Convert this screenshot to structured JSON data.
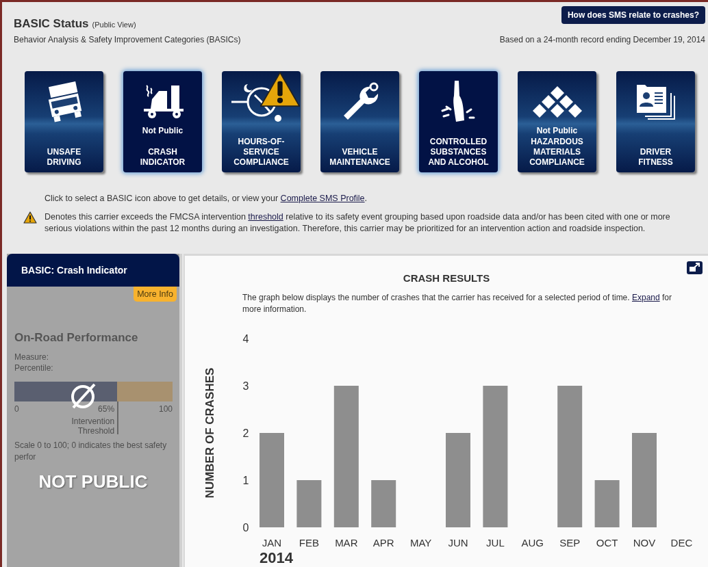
{
  "header": {
    "title": "BASIC Status",
    "title_note": "(Public View)",
    "subtitle": "Behavior Analysis & Safety Improvement Categories (BASICs)",
    "help_button": "How does SMS relate to crashes?",
    "record_note": "Based on a 24-month record ending December 19, 2014"
  },
  "basics": [
    {
      "kind": "truck",
      "label_lines": [
        "UNSAFE",
        "DRIVING"
      ],
      "highlighted": false,
      "warning": false
    },
    {
      "kind": "crash",
      "status": "Not Public",
      "label_lines": [
        "CRASH",
        "INDICATOR"
      ],
      "highlighted": true,
      "warning": false
    },
    {
      "kind": "clock",
      "label_lines": [
        "HOURS-OF-",
        "SERVICE",
        "COMPLIANCE"
      ],
      "highlighted": false,
      "warning": true
    },
    {
      "kind": "wrench",
      "label_lines": [
        "VEHICLE",
        "MAINTENANCE"
      ],
      "highlighted": false,
      "warning": false
    },
    {
      "kind": "bottle",
      "label_lines": [
        "CONTROLLED",
        "SUBSTANCES",
        "AND ALCOHOL"
      ],
      "highlighted": true,
      "warning": false
    },
    {
      "kind": "diamonds",
      "status": "Not Public",
      "label_lines": [
        "HAZARDOUS",
        "MATERIALS",
        "COMPLIANCE"
      ],
      "highlighted": false,
      "warning": false
    },
    {
      "kind": "idcard",
      "label_lines": [
        "DRIVER",
        "FITNESS"
      ],
      "highlighted": false,
      "warning": false
    }
  ],
  "notes": [
    {
      "kind": "plain",
      "before": "Click to select a BASIC icon above to get details, or view your ",
      "link": "Complete SMS Profile",
      "after": "."
    },
    {
      "kind": "warning",
      "before": "Denotes this carrier exceeds the FMCSA intervention ",
      "link": "threshold",
      "after": " relative to its safety event grouping based upon roadside data and/or has been cited with one or more serious violations within the past 12 months during an investigation. Therefore, this carrier may be prioritized for an intervention action and roadside inspection."
    }
  ],
  "panel": {
    "title": "BASIC: Crash Indicator",
    "more_info": "More Info",
    "section": "On-Road Performance",
    "measure": "Measure:",
    "percentile": "Percentile:",
    "scale": {
      "level": 0.65,
      "min": "0",
      "threshold": "65%",
      "max": "100",
      "threshold_label": "Intervention Threshold"
    },
    "footnote": "Scale 0 to 100; 0 indicates the best safety perfor",
    "overlay_text": "NOT PUBLIC"
  },
  "results": {
    "title": "CRASH RESULTS",
    "description": "The graph below displays the number of crashes that the carrier has received for a selected period of time. ",
    "link": "Expand",
    "description_after": " for more information.",
    "year": "2014",
    "chart_data": {
      "type": "bar",
      "ylabel": "NUMBER OF CRASHES",
      "categories": [
        "JAN",
        "FEB",
        "MAR",
        "APR",
        "MAY",
        "JUN",
        "JUL",
        "AUG",
        "SEP",
        "OCT",
        "NOV",
        "DEC"
      ],
      "series": [
        {
          "color": "#8e8e8e",
          "values": [
            2,
            1,
            3,
            1,
            0,
            2,
            3,
            0,
            3,
            1,
            2,
            0
          ]
        }
      ],
      "ylim": [
        0,
        4
      ],
      "yticks": [
        0,
        1,
        2,
        3,
        4
      ]
    }
  }
}
